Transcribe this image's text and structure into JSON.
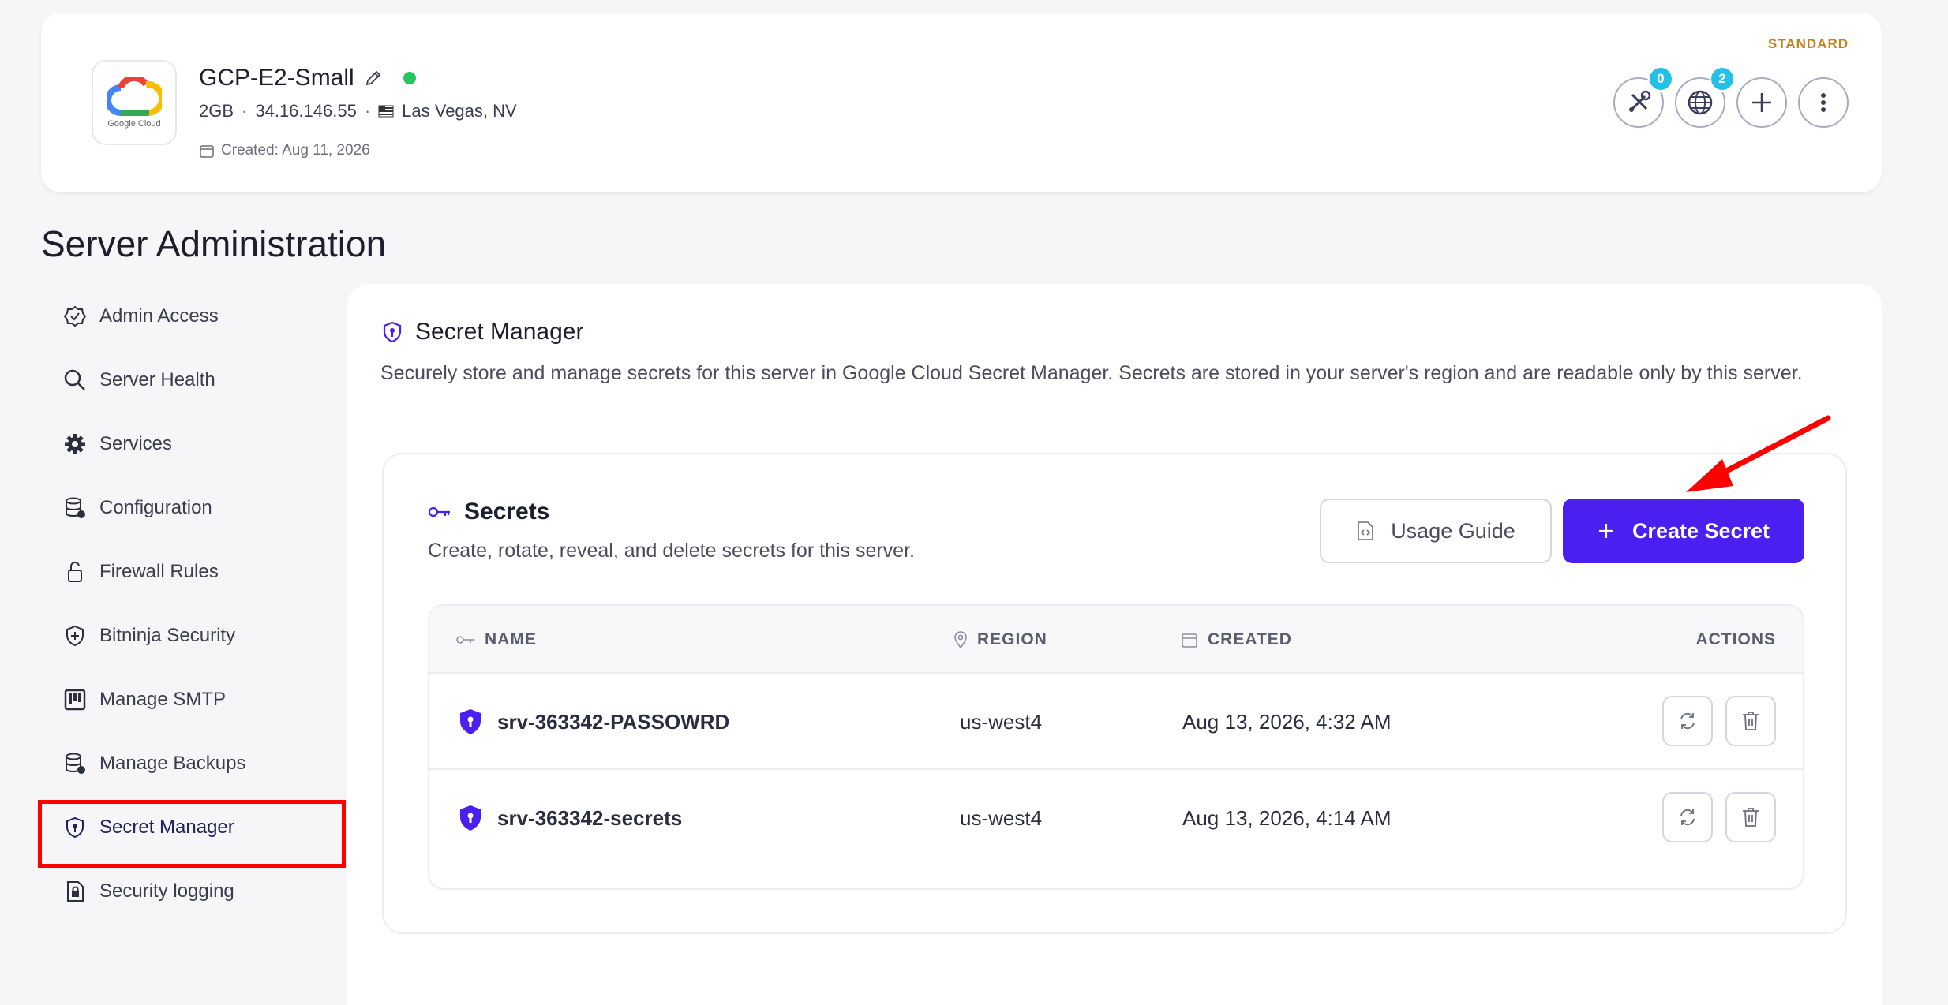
{
  "server": {
    "name": "GCP-E2-Small",
    "logo_caption": "Google Cloud",
    "ram": "2GB",
    "ip": "34.16.146.55",
    "location": "Las Vegas, NV",
    "created": "Created: Aug 11, 2026",
    "plan": "STANDARD",
    "status_color": "#22c55e",
    "actions": [
      {
        "icon": "tools-icon",
        "badge": "0"
      },
      {
        "icon": "globe-icon",
        "badge": "2"
      },
      {
        "icon": "plus-icon"
      },
      {
        "icon": "more-vertical-icon"
      }
    ]
  },
  "page_title": "Server Administration",
  "sidebar": {
    "items": [
      {
        "label": "Admin Access",
        "icon": "check-badge-icon"
      },
      {
        "label": "Server Health",
        "icon": "search-icon"
      },
      {
        "label": "Services",
        "icon": "gear-icon"
      },
      {
        "label": "Configuration",
        "icon": "database-icon"
      },
      {
        "label": "Firewall Rules",
        "icon": "lock-icon"
      },
      {
        "label": "Bitninja Security",
        "icon": "shield-icon"
      },
      {
        "label": "Manage SMTP",
        "icon": "mail-server-icon"
      },
      {
        "label": "Manage Backups",
        "icon": "database-icon"
      },
      {
        "label": "Secret Manager",
        "icon": "shield-key-icon",
        "active": true
      },
      {
        "label": "Security logging",
        "icon": "file-lock-icon"
      }
    ]
  },
  "panel": {
    "title": "Secret Manager",
    "description": "Securely store and manage secrets for this server in Google Cloud Secret Manager. Secrets are stored in your server's region and are readable only by this server."
  },
  "secrets": {
    "title": "Secrets",
    "subtitle": "Create, rotate, reveal, and delete secrets for this server.",
    "guide_button": "Usage Guide",
    "create_button": "Create Secret",
    "accent_color": "#4b1ff0",
    "columns": {
      "name": "NAME",
      "region": "REGION",
      "created": "CREATED",
      "actions": "ACTIONS"
    },
    "rows": [
      {
        "name": "srv-363342-PASSOWRD",
        "region": "us-west4",
        "created": "Aug 13, 2026, 4:32 AM"
      },
      {
        "name": "srv-363342-secrets",
        "region": "us-west4",
        "created": "Aug 13, 2026, 4:14 AM"
      }
    ]
  }
}
